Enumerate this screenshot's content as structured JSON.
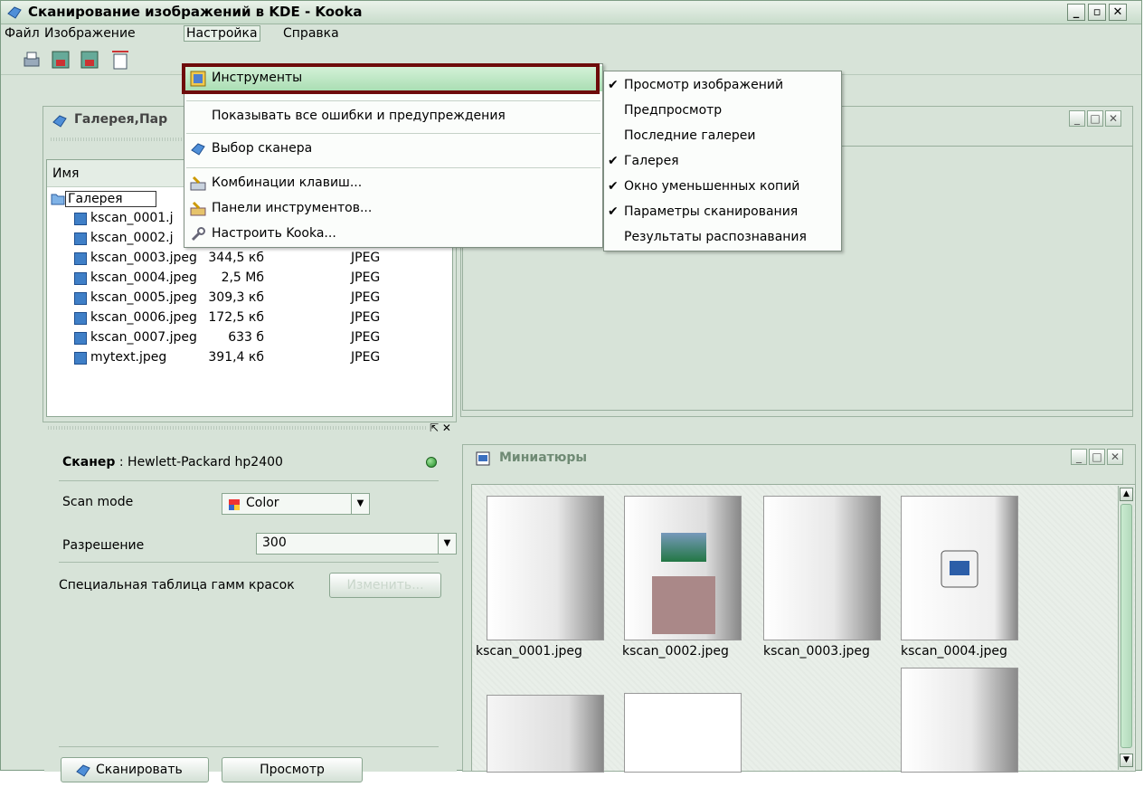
{
  "window": {
    "title": "Сканирование изображений в KDE - Kooka",
    "min_label": "_",
    "max_label": "▫",
    "close_label": "✕"
  },
  "menubar": {
    "file": "Файл",
    "image": "Изображение",
    "settings": "Настройка",
    "help": "Справка"
  },
  "gallery_panel": {
    "title": "Галерея,Пар",
    "column_name": "Имя",
    "root": "Галерея",
    "files": [
      {
        "name": "kscan_0001.j",
        "size": "",
        "type": ""
      },
      {
        "name": "kscan_0002.j",
        "size": "",
        "type": ""
      },
      {
        "name": "kscan_0003.jpeg",
        "size": "344,5 кб",
        "type": "JPEG"
      },
      {
        "name": "kscan_0004.jpeg",
        "size": "2,5 Мб",
        "type": "JPEG"
      },
      {
        "name": "kscan_0005.jpeg",
        "size": "309,3 кб",
        "type": "JPEG"
      },
      {
        "name": "kscan_0006.jpeg",
        "size": "172,5 кб",
        "type": "JPEG"
      },
      {
        "name": "kscan_0007.jpeg",
        "size": "633 б",
        "type": "JPEG"
      },
      {
        "name": "mytext.jpeg",
        "size": "391,4 кб",
        "type": "JPEG"
      }
    ],
    "close_label": "⇱ ✕"
  },
  "scanner": {
    "label_bold": "Сканер",
    "label_rest": " : Hewlett-Packard hp2400",
    "scan_mode_label": "Scan mode",
    "scan_mode_value": "Color",
    "resolution_label": "Разрешение",
    "resolution_value": "300",
    "gamma_label": "Специальная таблица гамм красок",
    "gamma_button": "Изменить...",
    "scan_button": "Сканировать",
    "preview_button": "Просмотр"
  },
  "thumbnails_panel": {
    "title": "Миниатюры",
    "items": [
      "kscan_0001.jpeg",
      "kscan_0002.jpeg",
      "kscan_0003.jpeg",
      "kscan_0004.jpeg"
    ]
  },
  "settings_menu": {
    "items": [
      "Инструменты",
      "Показывать все ошибки и предупреждения",
      "Выбор сканера",
      "Комбинации клавиш...",
      "Панели инструментов...",
      "Настроить Kooka..."
    ]
  },
  "tools_submenu": {
    "items": [
      {
        "label": "Просмотр изображений",
        "checked": "✔"
      },
      {
        "label": "Предпросмотр",
        "checked": ""
      },
      {
        "label": "Последние галереи",
        "checked": ""
      },
      {
        "label": "Галерея",
        "checked": "✔"
      },
      {
        "label": "Окно уменьшенных копий",
        "checked": "✔"
      },
      {
        "label": "Параметры сканирования",
        "checked": "✔"
      },
      {
        "label": "Результаты распознавания",
        "checked": ""
      }
    ]
  },
  "colors": {
    "background": "#d7e3d8",
    "highlight": "#a9ddb2",
    "frame": "#6e0b0b"
  }
}
